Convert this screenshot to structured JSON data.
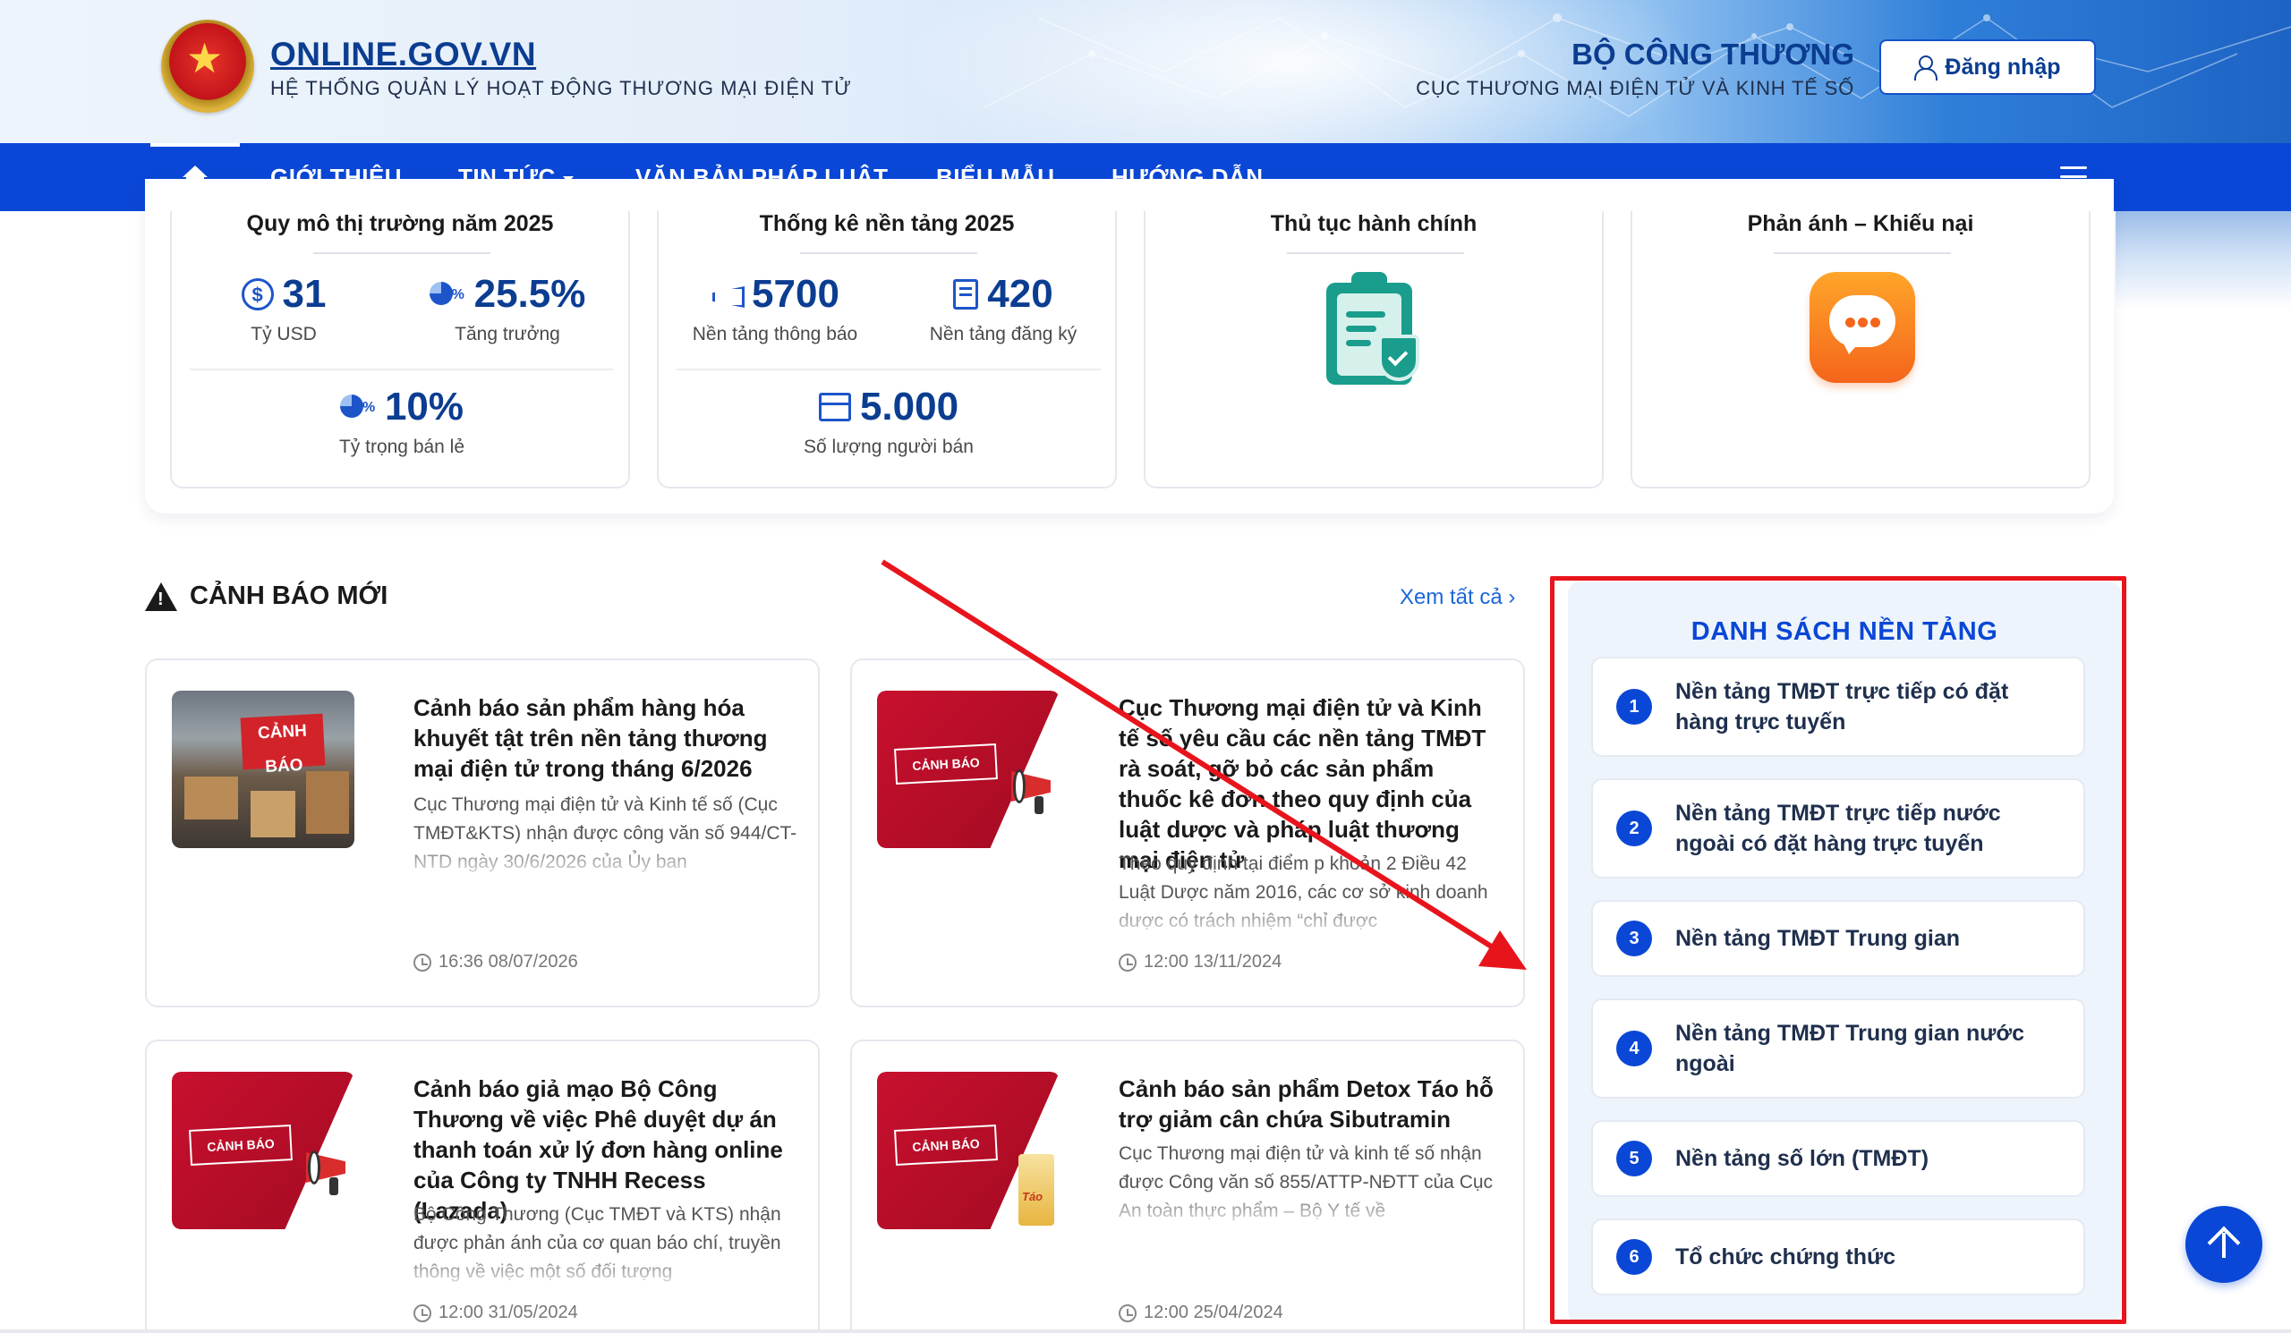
{
  "header": {
    "site_title": "ONLINE.GOV.VN",
    "site_subtitle": "HỆ THỐNG QUẢN LÝ HOẠT ĐỘNG THƯƠNG MẠI ĐIỆN TỬ",
    "ministry": "BỘ CÔNG THƯƠNG",
    "department": "CỤC THƯƠNG MẠI ĐIỆN TỬ VÀ KINH TẾ SỐ",
    "login_label": "Đăng nhập"
  },
  "nav": {
    "items": [
      {
        "label": "GIỚI THIỆU"
      },
      {
        "label": "TIN TỨC"
      },
      {
        "label": "VĂN BẢN PHÁP LUẬT"
      },
      {
        "label": "BIỂU MẪU"
      },
      {
        "label": "HƯỚNG DẪN"
      }
    ]
  },
  "stats": {
    "market": {
      "title": "Quy mô thị trường năm 2025",
      "a_value": "31",
      "a_label": "Tỷ USD",
      "b_value": "25.5%",
      "b_label": "Tăng trưởng",
      "c_value": "10%",
      "c_label": "Tỷ trọng bán lẻ"
    },
    "platforms": {
      "title": "Thống kê nền tảng 2025",
      "a_value": "5700",
      "a_label": "Nền tảng thông báo",
      "b_value": "420",
      "b_label": "Nền tảng đăng ký",
      "c_value": "5.000",
      "c_label": "Số lượng người bán"
    },
    "procedures": {
      "title": "Thủ tục hành chính"
    },
    "feedback": {
      "title": "Phản ánh – Khiếu nại"
    }
  },
  "alerts": {
    "title": "CẢNH BÁO MỚI",
    "view_all": "Xem tất cả ›",
    "items": [
      {
        "title": "Cảnh báo sản phẩm hàng hóa khuyết tật trên nền tảng thương mại điện tử trong tháng 6/2026",
        "desc": "Cục Thương mại điện tử và Kinh tế số (Cục TMĐT&KTS) nhận được công văn số 944/CT-NTD ngày 30/6/2026 của Ủy ban",
        "time": "16:36 08/07/2026",
        "image_text": "CẢNH BÁO"
      },
      {
        "title": "Cục Thương mại điện tử và Kinh tế số yêu cầu các nền tảng TMĐT rà soát, gỡ bỏ các sản phẩm thuốc kê đơn theo quy định của luật dược và pháp luật thương mại điện tử",
        "desc": "Theo quy định tại điểm p khoản 2 Điều 42 Luật Dược năm 2016, các cơ sở kinh doanh dược có trách nhiệm “chỉ được",
        "time": "12:00 13/11/2024",
        "image_text": "CẢNH BÁO"
      },
      {
        "title": "Cảnh báo giả mạo Bộ Công Thương về việc Phê duyệt dự án thanh toán xử lý đơn hàng online của Công ty TNHH Recess (Lazada)",
        "desc": "Bộ Công Thương (Cục TMĐT và KTS) nhận được phản ánh của cơ quan báo chí, truyền thông về việc một số đối tượng",
        "time": "12:00 31/05/2024",
        "image_text": "CẢNH BÁO"
      },
      {
        "title": "Cảnh báo sản phẩm Detox Táo hỗ trợ giảm cân chứa Sibutramin",
        "desc": "Cục Thương mại điện tử và kinh tế số nhận được Công văn số 855/ATTP-NĐTT của Cục An toàn thực phẩm – Bộ Y tế về",
        "time": "12:00 25/04/2024",
        "image_text": "CẢNH BÁO",
        "product_text": "Táo"
      }
    ]
  },
  "platform_list": {
    "title": "DANH SÁCH NỀN TẢNG",
    "items": [
      {
        "num": "1",
        "label": "Nền tảng TMĐT trực tiếp có đặt hàng trực tuyến"
      },
      {
        "num": "2",
        "label": "Nền tảng TMĐT trực tiếp nước ngoài có đặt hàng trực tuyến"
      },
      {
        "num": "3",
        "label": "Nền tảng TMĐT Trung gian"
      },
      {
        "num": "4",
        "label": "Nền tảng TMĐT Trung gian nước ngoài"
      },
      {
        "num": "5",
        "label": "Nền tảng số lớn (TMĐT)"
      },
      {
        "num": "6",
        "label": "Tổ chức chứng thức"
      }
    ]
  },
  "colors": {
    "primary": "#0a47d6",
    "brand_text": "#0b3d91",
    "annotation_red": "#e8141c"
  }
}
